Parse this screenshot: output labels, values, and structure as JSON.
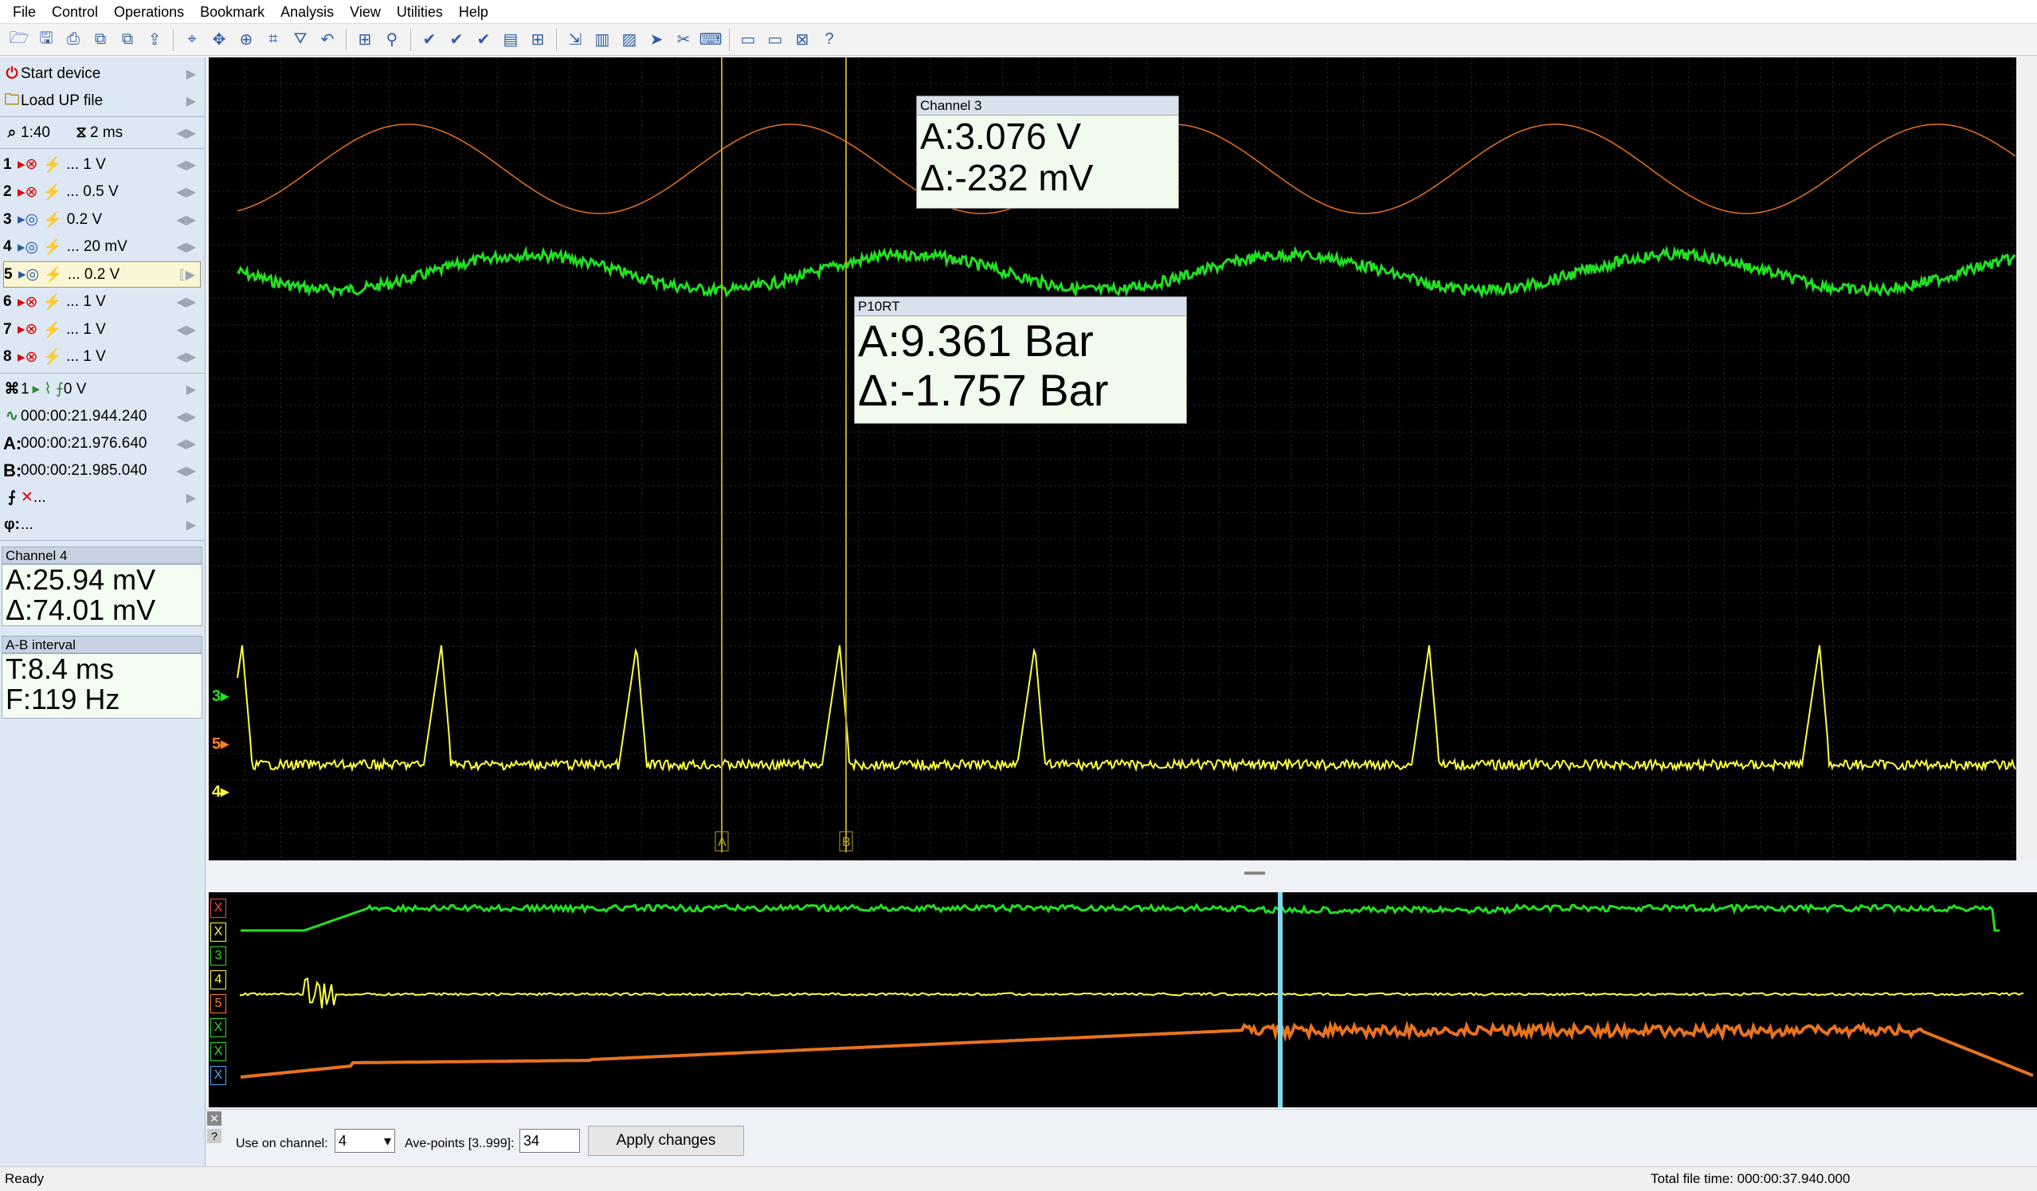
{
  "menu": [
    "File",
    "Control",
    "Operations",
    "Bookmark",
    "Analysis",
    "View",
    "Utilities",
    "Help"
  ],
  "toolbar_icons": [
    "open-icon",
    "save-icon",
    "print-icon",
    "copy-icon",
    "paste-icon",
    "export-icon",
    "cursor-icon",
    "move-icon",
    "zoom-icon",
    "measure-icon",
    "filter-icon",
    "undo-icon",
    "layout-icon",
    "pin-icon",
    "check-icon",
    "check-all-icon",
    "check-down-icon",
    "page-icon",
    "grid-icon",
    "scale-icon",
    "chart-icon",
    "palette-icon",
    "arrow-icon",
    "cut-icon",
    "keyboard-icon",
    "frame-icon",
    "frame-alt-icon",
    "close-frame-icon",
    "help-icon"
  ],
  "sidebar": {
    "start_device": "Start device",
    "load_file": "Load UP file",
    "zoom": "1:40",
    "timebase": "2 ms",
    "channels": [
      {
        "num": "1",
        "scale": "... 1 V"
      },
      {
        "num": "2",
        "scale": "... 0.5 V"
      },
      {
        "num": "3",
        "scale": "0.2 V"
      },
      {
        "num": "4",
        "scale": "... 20 mV"
      },
      {
        "num": "5",
        "scale": "... 0.2 V"
      },
      {
        "num": "6",
        "scale": "... 1 V"
      },
      {
        "num": "7",
        "scale": "... 1 V"
      },
      {
        "num": "8",
        "scale": "... 1 V"
      }
    ],
    "trigger_channel": "1",
    "trigger_level": "0 V",
    "time_ref": "000:00:21.944.240",
    "cursor_a": "000:00:21.976.640",
    "cursor_b": "000:00:21.985.040",
    "math": "...",
    "phase": "...",
    "label_a": "A:",
    "label_b": "B:",
    "phi": "φ:"
  },
  "channel4_panel": {
    "title": "Channel 4",
    "a_value": "A:25.94 mV",
    "delta_value": "Δ:74.01 mV"
  },
  "ab_panel": {
    "title": "A-B interval",
    "t_value": "T:8.4 ms",
    "f_value": "F:119 Hz"
  },
  "scope": {
    "channel3_box": {
      "title": "Channel 3",
      "a_value": "A:3.076 V",
      "delta_value": "Δ:-232 mV"
    },
    "p10rt_box": {
      "title": "P10RT",
      "a_value": "A:9.361 Bar",
      "delta_value": "Δ:-1.757 Bar"
    },
    "markers": [
      {
        "label": "3",
        "color": "#22e022"
      },
      {
        "label": "5",
        "color": "#ff7f1e"
      },
      {
        "label": "4",
        "color": "#ffff44"
      }
    ],
    "cursor_a_label": "A",
    "cursor_b_label": "B"
  },
  "overview_channels": [
    "X",
    "X",
    "3",
    "4",
    "5",
    "X",
    "X",
    "X"
  ],
  "bottom": {
    "use_channel_label": "Use on channel:",
    "channel_value": "4",
    "ave_points_label": "Ave-points [3..999]:",
    "ave_points_value": "34",
    "apply_label": "Apply changes"
  },
  "status": {
    "left": "Ready",
    "right": "Total file time: 000:00:37.940.000"
  },
  "colors": {
    "green_trace": "#22e022",
    "orange_trace": "#e8731e",
    "yellow_trace": "#ffff44",
    "cursor_line": "#b9a317"
  }
}
